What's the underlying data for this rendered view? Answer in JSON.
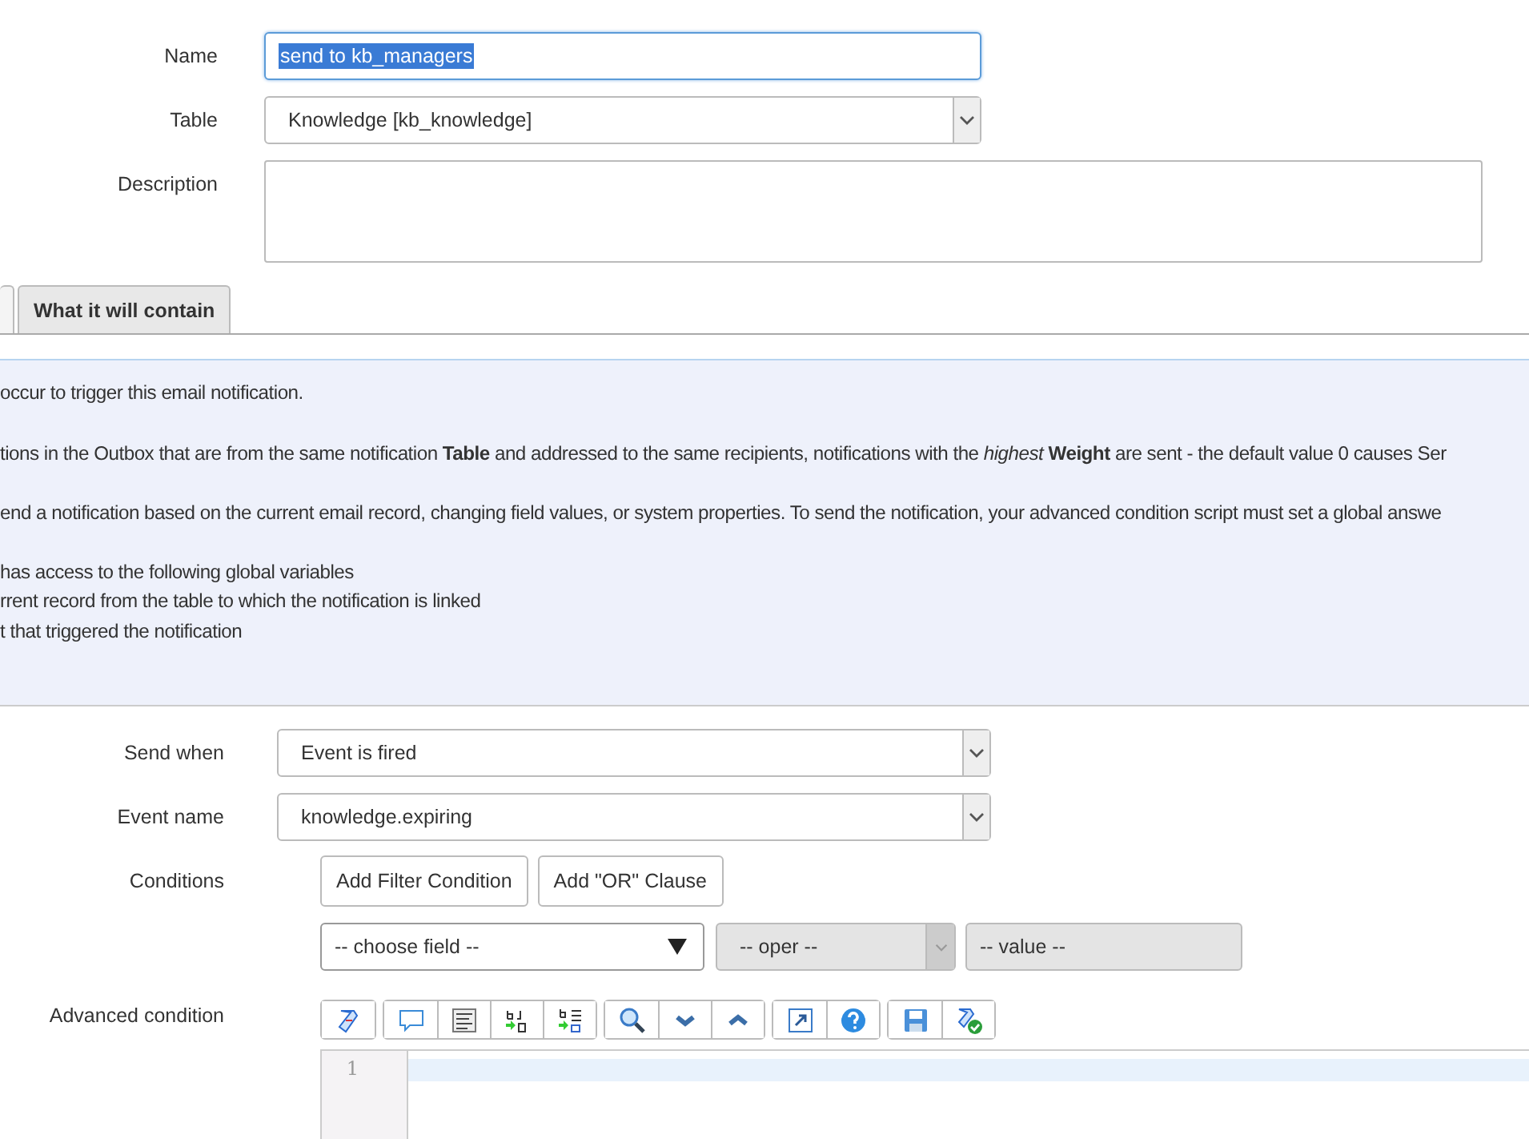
{
  "form_top": [
    {
      "kind": "text",
      "label": "Name",
      "value": "send to kb_managers",
      "highlighted": true
    },
    {
      "kind": "select",
      "label": "Table",
      "value": "Knowledge [kb_knowledge]"
    },
    {
      "kind": "textarea",
      "label": "Description"
    }
  ],
  "tabs": [
    {
      "selected": true
    },
    {
      "label": "What it will contain",
      "selected": false
    }
  ],
  "info_lines": [
    "occur to trigger this email notification.",
    "tions in the Outbox that are from the same notification **Table** and addressed to the same recipients, notifications with the *highest* **Weight** are sent - the default value 0 causes Ser",
    "end a notification based on the current email record, changing field values, or system properties. To send the notification, your advanced condition script must set a global answe",
    "has access to the following global variables",
    "rrent record from the table to which the notification is linked",
    "t that triggered the notification"
  ],
  "form_bottom": [
    {
      "kind": "select",
      "label": "Send when",
      "value": "Event is fired"
    },
    {
      "kind": "select",
      "label": "Event name",
      "value": "knowledge.expiring"
    }
  ],
  "conditions": {
    "label": "Conditions",
    "buttons": [
      "Add Filter Condition",
      "Add \"OR\" Clause"
    ],
    "field": "-- choose field --",
    "operator": {
      "value": "-- oper --",
      "disabled": true
    },
    "value": {
      "placeholder": "-- value --",
      "disabled": true
    }
  },
  "advanced": {
    "label": "Advanced condition",
    "line_numbers": [
      "1"
    ]
  }
}
